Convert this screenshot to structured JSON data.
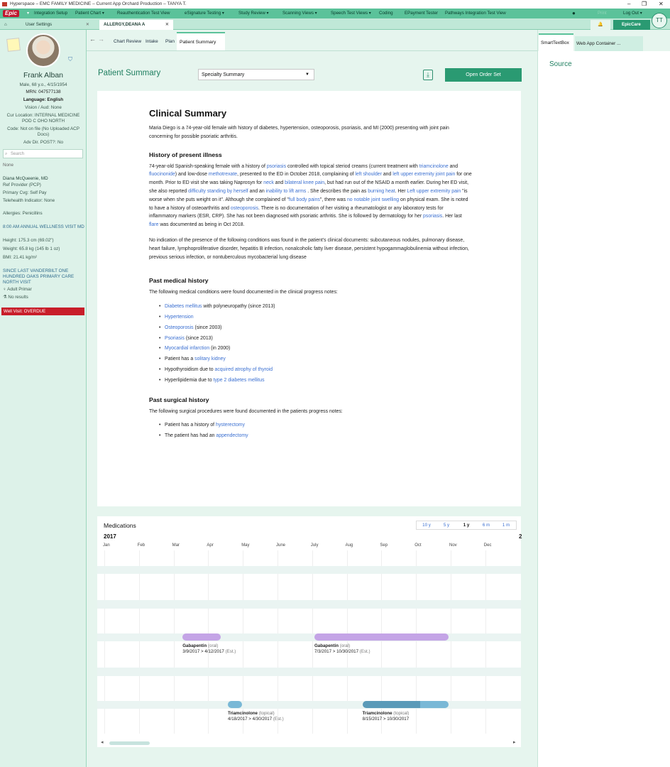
{
  "window": {
    "title": "Hyperspace – EMC FAMILY MEDICINE – Current App Orchard Production – TANYA T.",
    "min": "–",
    "max": "❐",
    "close": "✕"
  },
  "menubar": {
    "epic": "Epic",
    "items": [
      "Integration Setup",
      "Patient Chart ▾",
      "Reauthentication Test View",
      "eSignature Testing ▾",
      "Study Review ▾",
      "Scanning Views ▾",
      "Speech Test Views ▾",
      "Coding",
      "EPayment Tester",
      "Pathways Integration Test View"
    ],
    "print": "Print",
    "logout": "Log Out ▾",
    "epiccare": "EpicCare",
    "user_initials": "TT"
  },
  "patient_tabs": {
    "home_icon": "home-icon",
    "user_settings": "User Settings",
    "patient": "ALLERGY,DEANA A"
  },
  "patient": {
    "name": "Frank Alban",
    "demo": "Male, 68 y.o., 4/15/1954",
    "mrn": "MRN: 047577138",
    "language": "Language: English",
    "vision": "Vision / Aud: None",
    "location": "Cur Location: INTERNAL MEDICINE POD C OHO NORTH",
    "code": "Code: Not on file (No Uploaded ACP Docs)",
    "adv": "Adv Dir. POST?: No",
    "search_placeholder": "Search",
    "none": "None",
    "pcp": "Diana McQueenie, MD",
    "pcp_role": "Ref Provider (PCP)",
    "coverage": "Primary Cvg: Self Pay",
    "telehealth": "Telehealth Indicator: None",
    "allergies": "Allergies: Penicillins",
    "visit": "8:00 AM ANNUAL WELLNESS VISIT MD",
    "height": "Height: 175.3 cm (69.02\")",
    "weight": "Weight: 65.8 kg (145 lb 1 oz)",
    "bmi": "BMI: 21.41 kg/m²",
    "since": "SINCE LAST VANDERBILT ONE HUNDRED OAKS PRIMARY CARE NORTH VISIT",
    "adult": "Adult Primar",
    "noresults": "No results",
    "overdue": "Well Visit: OVERDUE"
  },
  "nav": {
    "back": "←",
    "fwd": "→",
    "tabs": [
      "Chart Review",
      "Intake",
      "Plan"
    ],
    "active": "Patient Summary"
  },
  "summary": {
    "title": "Patient Summary",
    "specialty": "Specialty Summary",
    "order_btn": "Open Order Set",
    "download": "⤓"
  },
  "doc": {
    "title": "Clinical Summary",
    "intro": "Maria Diego is a 74-year-old female with history of diabetes, hypertension, osteoporosis, psoriasis, and MI (2000) presenting with joint pain concerning for possible psoriatic arthritis.",
    "hpi_title": "History of present illness",
    "hpi": [
      [
        "t",
        "74-year-old Spanish-speaking female with a history of "
      ],
      [
        "l",
        "psoriasis"
      ],
      [
        "t",
        " controlled with topical steriod creams (current treatment with "
      ],
      [
        "l",
        "triamcinolone"
      ],
      [
        "t",
        " and "
      ],
      [
        "l",
        "fluocinonide"
      ],
      [
        "t",
        ") and low-dose "
      ],
      [
        "l",
        "methotrexate"
      ],
      [
        "t",
        ", presented to the ED in October 2018, complaining of "
      ],
      [
        "l",
        "left shoulder"
      ],
      [
        "t",
        " and "
      ],
      [
        "l",
        "left upper extremity joint pain"
      ],
      [
        "t",
        " for one month. Prior to ED visit she was taking Naprosyn for "
      ],
      [
        "l",
        "neck"
      ],
      [
        "t",
        " and "
      ],
      [
        "l",
        "bilateral knee pain"
      ],
      [
        "t",
        ", but had run out of the NSAID a month earlier. During her ED visit, she also reported "
      ],
      [
        "l",
        "difficulty standing by herself"
      ],
      [
        "t",
        " and an "
      ],
      [
        "l",
        "inability to lift arms"
      ],
      [
        "t",
        " . She describes the pain as "
      ],
      [
        "l",
        "burning heat"
      ],
      [
        "t",
        ". Her "
      ],
      [
        "l",
        "Left upper extremity pain"
      ],
      [
        "t",
        " \"is worse when she puts weight on it\". Although she complained of \""
      ],
      [
        "l",
        "full body pains"
      ],
      [
        "t",
        "\", there was "
      ],
      [
        "l",
        "no notable joint swelling"
      ],
      [
        "t",
        " on physical exam. She is noted to have a history of osteoarthritis and "
      ],
      [
        "l",
        "osteoporosis"
      ],
      [
        "t",
        ". There is no documentation of her visiting a rheumatologist or any laboratory tests for inflammatory markers (ESR, CRP). She has not been diagnosed with psoriatic arthritis. She is followed by dermatology for her "
      ],
      [
        "l",
        "psoriasis"
      ],
      [
        "t",
        ". Her last "
      ],
      [
        "l",
        "flare"
      ],
      [
        "t",
        " was documented as being in Oct 2018."
      ]
    ],
    "neg": "No indication of the presence of the following conditions was found in the patient's clinical documents: subcutaneous nodules, pulmonary disease, heart failure, lymphoproliferative disorder, hepatitis B infection, nonalcoholic fatty liver disease, persistent hypogammaglobulinemia without infection, previous serious infection, or nontuberculous mycobacterial lung disease",
    "pmh_title": "Past medical history",
    "pmh_intro": "The following medical conditions were found documented in the clinical progress notes:",
    "pmh": [
      [
        [
          "l",
          "Diabetes mellitus"
        ],
        [
          "t",
          " with polyneuropathy (since 2013)"
        ]
      ],
      [
        [
          "l",
          "Hypertension"
        ]
      ],
      [
        [
          "l",
          "Osteoporosis"
        ],
        [
          "t",
          " (since 2003)"
        ]
      ],
      [
        [
          "l",
          "Psoriasis"
        ],
        [
          "t",
          " (since 2013)"
        ]
      ],
      [
        [
          "l",
          "Myocardial infarction"
        ],
        [
          "t",
          " (in 2000)"
        ]
      ],
      [
        [
          "t",
          "Patient has a "
        ],
        [
          "l",
          "solitary kidney"
        ]
      ],
      [
        [
          "t",
          "Hypothyroidism due to "
        ],
        [
          "l",
          "acquired atrophy of thyroid"
        ]
      ],
      [
        [
          "t",
          "Hyperlipidemia due to "
        ],
        [
          "l",
          "type 2 diabetes mellitus"
        ]
      ]
    ],
    "psh_title": "Past surgical history",
    "psh_intro": "The following surgical procedures were found documented in the patients progress notes:",
    "psh": [
      [
        [
          "t",
          "Patient has a history of "
        ],
        [
          "l",
          "hysterectomy"
        ]
      ],
      [
        [
          "t",
          "The patient has had an "
        ],
        [
          "l",
          "appendectomy"
        ]
      ]
    ]
  },
  "meds": {
    "title": "Medications",
    "year": "2017",
    "next_year_mark": "2",
    "ranges": [
      "10 y",
      "5 y",
      "1 y",
      "6 m",
      "1 m"
    ],
    "active_range": "1 y",
    "months": [
      "Jan",
      "Feb",
      "Mar",
      "Apr",
      "May",
      "June",
      "July",
      "Aug",
      "Sep",
      "Oct",
      "Nov",
      "Dec"
    ],
    "colors": {
      "gabapentin": "#c4a4e6",
      "triamcinolone": "#79b8d6",
      "triamcinolone_dark": "#5a9ab8",
      "stripe": "#eaf4f2"
    },
    "items": [
      {
        "name": "Gabapentin",
        "route": "(oral)",
        "range": "3/9/2017  >  4/12/2017",
        "est": "(Est.)"
      },
      {
        "name": "Gabapentin",
        "route": "(oral)",
        "range": "7/3/2017  >  10/30/2017",
        "est": "(Est.)"
      },
      {
        "name": "Triamcinolone",
        "route": "(topical)",
        "range": "4/18/2017  >  4/30/2017",
        "est": "(Est.)"
      },
      {
        "name": "Triamcinolone",
        "route": "(topical)",
        "range": "8/15/2017  >  10/30/2017",
        "est": ""
      }
    ],
    "scroll_left": "◂",
    "scroll_right": "▸"
  },
  "rightpane": {
    "tab1": "SmartTextBox",
    "tab2": "Web App Container",
    "more": "...",
    "source": "Source"
  }
}
